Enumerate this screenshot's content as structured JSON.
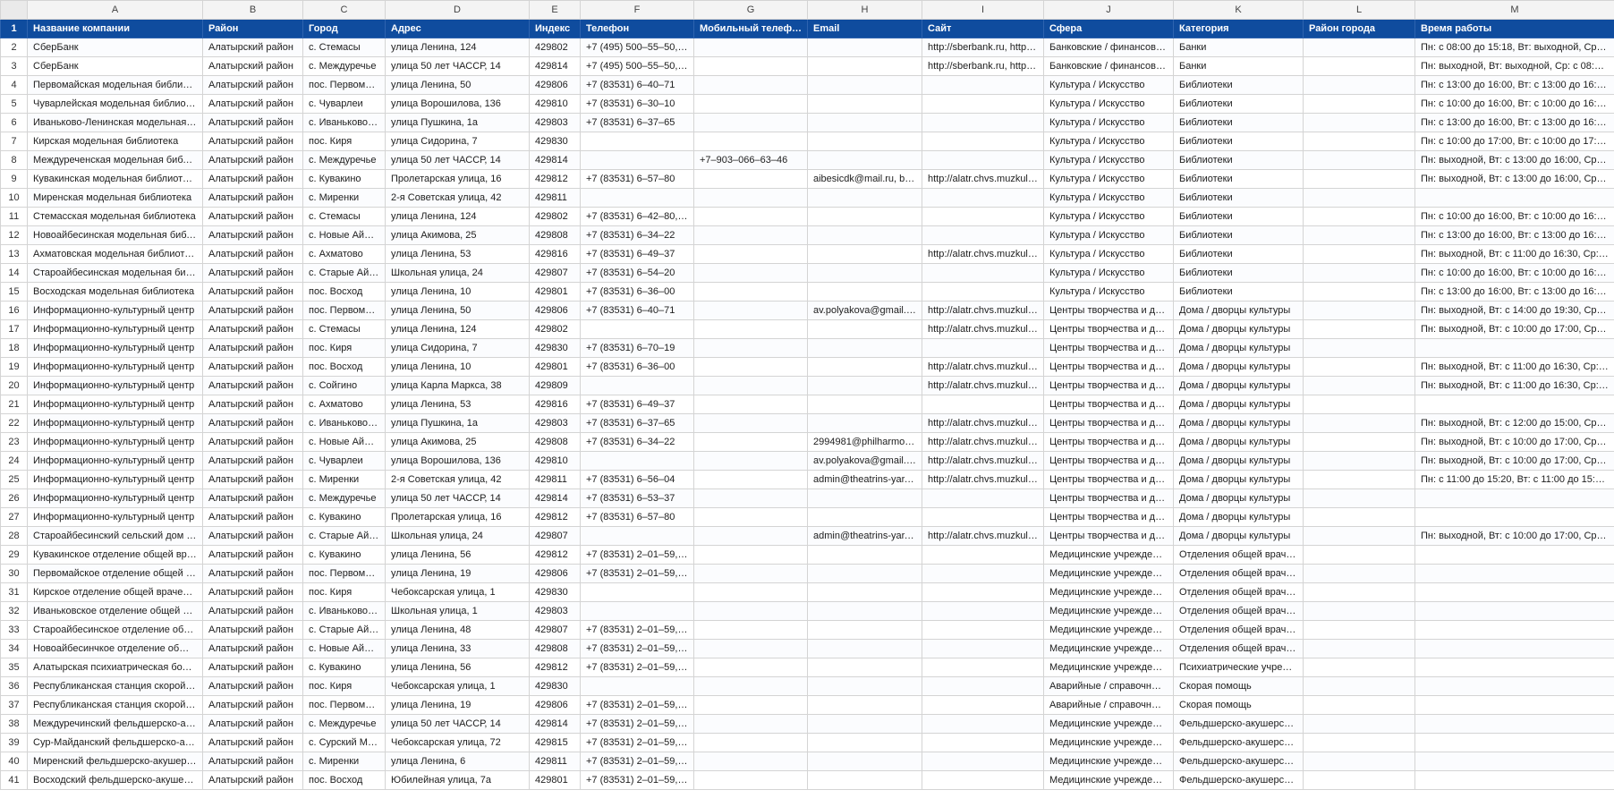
{
  "columns": [
    "A",
    "B",
    "C",
    "D",
    "E",
    "F",
    "G",
    "H",
    "I",
    "J",
    "K",
    "L",
    "M"
  ],
  "header_row_number": "1",
  "headers": [
    "Название компании",
    "Район",
    "Город",
    "Адрес",
    "Индекс",
    "Телефон",
    "Мобильный телефон",
    "Email",
    "Сайт",
    "Сфера",
    "Категория",
    "Район города",
    "Время работы"
  ],
  "rows": [
    {
      "n": "2",
      "c": [
        "СберБанк",
        "Алатырский район",
        "с. Стемасы",
        "улица Ленина, 124",
        "429802",
        "+7 (495) 500–55–50, 8–...",
        "",
        "",
        "http://sberbank.ru, http://...",
        "Банковские / финансовые ...",
        "Банки",
        "",
        "Пн: с 08:00 до 15:18, Вт: выходной, Ср: выход"
      ]
    },
    {
      "n": "3",
      "c": [
        "СберБанк",
        "Алатырский район",
        "с. Междуречье",
        "улица 50 лет ЧАССР, 14",
        "429814",
        "+7 (495) 500–55–50, 8–...",
        "",
        "",
        "http://sberbank.ru, http://...",
        "Банковские / финансовые ...",
        "Банки",
        "",
        "Пн: выходной, Вт: выходной, Ср: с 08:30 до 1"
      ]
    },
    {
      "n": "4",
      "c": [
        "Первомайская модельная библиотека",
        "Алатырский район",
        "пос. Первомай...",
        "улица Ленина, 50",
        "429806",
        "+7 (83531) 6–40–71",
        "",
        "",
        "",
        "Культура / Искусство",
        "Библиотеки",
        "",
        "Пн: с 13:00 до 16:00, Вт: с 13:00 до 16:00, Ср:"
      ]
    },
    {
      "n": "5",
      "c": [
        "Чуварлейская модельная библиотека",
        "Алатырский район",
        "с. Чуварлеи",
        "улица Ворошилова, 136",
        "429810",
        "+7 (83531) 6–30–10",
        "",
        "",
        "",
        "Культура / Искусство",
        "Библиотеки",
        "",
        "Пн: с 10:00 до 16:00, Вт: с 10:00 до 16:00, Ср:"
      ]
    },
    {
      "n": "6",
      "c": [
        "Иваньково-Ленинская модельная би...",
        "Алатырский район",
        "с. Иваньково-Л...",
        "улица Пушкина, 1а",
        "429803",
        "+7 (83531) 6–37–65",
        "",
        "",
        "",
        "Культура / Искусство",
        "Библиотеки",
        "",
        "Пн: с 13:00 до 16:00, Вт: с 13:00 до 16:00, Ср:"
      ]
    },
    {
      "n": "7",
      "c": [
        "Кирская модельная библиотека",
        "Алатырский район",
        "пос. Киря",
        "улица Сидорина, 7",
        "429830",
        "",
        "",
        "",
        "",
        "Культура / Искусство",
        "Библиотеки",
        "",
        "Пн: с 10:00 до 17:00, Вт: с 10:00 до 17:00, Ср:"
      ]
    },
    {
      "n": "8",
      "c": [
        "Междуреченская модельная библиот...",
        "Алатырский район",
        "с. Междуречье",
        "улица 50 лет ЧАССР, 14",
        "429814",
        "",
        "+7–903–066–63–46",
        "",
        "",
        "Культура / Искусство",
        "Библиотеки",
        "",
        "Пн: выходной, Вт: с 13:00 до 16:00, Ср: с 13:0"
      ]
    },
    {
      "n": "9",
      "c": [
        "Кувакинская модельная библиотека",
        "Алатырский район",
        "с. Кувакино",
        "Пролетарская улица, 16",
        "429812",
        "+7 (83531) 6–57–80",
        "",
        "aibesicdk@mail.ru, biblk...",
        "http://alatr.chvs.muzkult.ru",
        "Культура / Искусство",
        "Библиотеки",
        "",
        "Пн: выходной, Вт: с 13:00 до 16:00, Ср: с 13:0"
      ]
    },
    {
      "n": "10",
      "c": [
        "Миренская модельная библиотека",
        "Алатырский район",
        "с. Миренки",
        "2-я Советская улица, 42",
        "429811",
        "",
        "",
        "",
        "",
        "Культура / Искусство",
        "Библиотеки",
        "",
        ""
      ]
    },
    {
      "n": "11",
      "c": [
        "Стемасская модельная библиотека",
        "Алатырский район",
        "с. Стемасы",
        "улица Ленина, 124",
        "429802",
        "+7 (83531) 6–42–80, +7...",
        "",
        "",
        "",
        "Культура / Искусство",
        "Библиотеки",
        "",
        "Пн: с 10:00 до 16:00, Вт: с 10:00 до 16:00, Ср:"
      ]
    },
    {
      "n": "12",
      "c": [
        "Новоайбесинская модельная библио...",
        "Алатырский район",
        "с. Новые Айбеси",
        "улица Акимова, 25",
        "429808",
        "+7 (83531) 6–34–22",
        "",
        "",
        "",
        "Культура / Искусство",
        "Библиотеки",
        "",
        "Пн: с 13:00 до 16:00, Вт: с 13:00 до 16:00, Ср:"
      ]
    },
    {
      "n": "13",
      "c": [
        "Ахматовская модельная библиотека",
        "Алатырский район",
        "с. Ахматово",
        "улица Ленина, 53",
        "429816",
        "+7 (83531) 6–49–37",
        "",
        "",
        "http://alatr.chvs.muzkult.ru",
        "Культура / Искусство",
        "Библиотеки",
        "",
        "Пн: выходной, Вт: с 11:00 до 16:30, Ср: с 11:0"
      ]
    },
    {
      "n": "14",
      "c": [
        "Староайбесинская модельная библио...",
        "Алатырский район",
        "с. Старые Айбеси",
        "Школьная улица, 24",
        "429807",
        "+7 (83531) 6–54–20",
        "",
        "",
        "",
        "Культура / Искусство",
        "Библиотеки",
        "",
        "Пн: с 10:00 до 16:00, Вт: с 10:00 до 16:00, Ср:"
      ]
    },
    {
      "n": "15",
      "c": [
        "Восходская модельная библиотека",
        "Алатырский район",
        "пос. Восход",
        "улица Ленина, 10",
        "429801",
        "+7 (83531) 6–36–00",
        "",
        "",
        "",
        "Культура / Искусство",
        "Библиотеки",
        "",
        "Пн: с 13:00 до 16:00, Вт: с 13:00 до 16:00, Ср:"
      ]
    },
    {
      "n": "16",
      "c": [
        "Информационно-культурный центр",
        "Алатырский район",
        "пос. Первомай...",
        "улица Ленина, 50",
        "429806",
        "+7 (83531) 6–40–71",
        "",
        "av.polyakova@gmail.co...",
        "http://alatr.chvs.muzkult.r...",
        "Центры творчества и досуга",
        "Дома / дворцы культуры",
        "",
        "Пн: выходной, Вт: с 14:00 до 19:30, Ср: с 14:0"
      ]
    },
    {
      "n": "17",
      "c": [
        "Информационно-культурный центр",
        "Алатырский район",
        "с. Стемасы",
        "улица Ленина, 124",
        "429802",
        "",
        "",
        "",
        "http://alatr.chvs.muzkult.r...",
        "Центры творчества и досуга",
        "Дома / дворцы культуры",
        "",
        "Пн: выходной, Вт: с 10:00 до 17:00, Ср: с 10:0"
      ]
    },
    {
      "n": "18",
      "c": [
        "Информационно-культурный центр",
        "Алатырский район",
        "пос. Киря",
        "улица Сидорина, 7",
        "429830",
        "+7 (83531) 6–70–19",
        "",
        "",
        "",
        "Центры творчества и досуга",
        "Дома / дворцы культуры",
        "",
        ""
      ]
    },
    {
      "n": "19",
      "c": [
        "Информационно-культурный центр",
        "Алатырский район",
        "пос. Восход",
        "улица Ленина, 10",
        "429801",
        "+7 (83531) 6–36–00",
        "",
        "",
        "http://alatr.chvs.muzkult.r...",
        "Центры творчества и досуга",
        "Дома / дворцы культуры",
        "",
        "Пн: выходной, Вт: с 11:00 до 16:30, Ср: с 11:0"
      ]
    },
    {
      "n": "20",
      "c": [
        "Информационно-культурный центр",
        "Алатырский район",
        "с. Сойгино",
        "улица Карла Маркса, 38",
        "429809",
        "",
        "",
        "",
        "http://alatr.chvs.muzkult.r...",
        "Центры творчества и досуга",
        "Дома / дворцы культуры",
        "",
        "Пн: выходной, Вт: с 11:00 до 16:30, Ср: с 11:0"
      ]
    },
    {
      "n": "21",
      "c": [
        "Информационно-культурный центр",
        "Алатырский район",
        "с. Ахматово",
        "улица Ленина, 53",
        "429816",
        "+7 (83531) 6–49–37",
        "",
        "",
        "",
        "Центры творчества и досуга",
        "Дома / дворцы культуры",
        "",
        ""
      ]
    },
    {
      "n": "22",
      "c": [
        "Информационно-культурный центр",
        "Алатырский район",
        "с. Иваньково-Л...",
        "улица Пушкина, 1а",
        "429803",
        "+7 (83531) 6–37–65",
        "",
        "",
        "http://alatr.chvs.muzkult.r...",
        "Центры творчества и досуга",
        "Дома / дворцы культуры",
        "",
        "Пн: выходной, Вт: с 12:00 до 15:00, Ср: с 12:0"
      ]
    },
    {
      "n": "23",
      "c": [
        "Информационно-культурный центр",
        "Алатырский район",
        "с. Новые Айбеси",
        "улица Акимова, 25",
        "429808",
        "+7 (83531) 6–34–22",
        "",
        "2994981@philharmonia...",
        "http://alatr.chvs.muzkult.r...",
        "Центры творчества и досуга",
        "Дома / дворцы культуры",
        "",
        "Пн: выходной, Вт: с 10:00 до 17:00, Ср: с 10:0"
      ]
    },
    {
      "n": "24",
      "c": [
        "Информационно-культурный центр",
        "Алатырский район",
        "с. Чуварлеи",
        "улица Ворошилова, 136",
        "429810",
        "",
        "",
        "av.polyakova@gmail.co...",
        "http://alatr.chvs.muzkult.r...",
        "Центры творчества и досуга",
        "Дома / дворцы культуры",
        "",
        "Пн: выходной, Вт: с 10:00 до 17:00, Ср: с 10:0"
      ]
    },
    {
      "n": "25",
      "c": [
        "Информационно-культурный центр",
        "Алатырский район",
        "с. Миренки",
        "2-я Советская улица, 42",
        "429811",
        "+7 (83531) 6–56–04",
        "",
        "admin@theatrins-yar.ru,...",
        "http://alatr.chvs.muzkult.r...",
        "Центры творчества и досуга",
        "Дома / дворцы культуры",
        "",
        "Пн: с 11:00 до 15:20, Вт: с 11:00 до 15:20, Ср:"
      ]
    },
    {
      "n": "26",
      "c": [
        "Информационно-культурный центр",
        "Алатырский район",
        "с. Междуречье",
        "улица 50 лет ЧАССР, 14",
        "429814",
        "+7 (83531) 6–53–37",
        "",
        "",
        "",
        "Центры творчества и досуга",
        "Дома / дворцы культуры",
        "",
        ""
      ]
    },
    {
      "n": "27",
      "c": [
        "Информационно-культурный центр",
        "Алатырский район",
        "с. Кувакино",
        "Пролетарская улица, 16",
        "429812",
        "+7 (83531) 6–57–80",
        "",
        "",
        "",
        "Центры творчества и досуга",
        "Дома / дворцы культуры",
        "",
        ""
      ]
    },
    {
      "n": "28",
      "c": [
        "Староайбесинский сельский дом куль...",
        "Алатырский район",
        "с. Старые Айбеси",
        "Школьная улица, 24",
        "429807",
        "",
        "",
        "admin@theatrins-yar.ru,...",
        "http://alatr.chvs.muzkult.r...",
        "Центры творчества и досуга",
        "Дома / дворцы культуры",
        "",
        "Пн: выходной, Вт: с 10:00 до 17:00, Ср: с 10:0"
      ]
    },
    {
      "n": "29",
      "c": [
        "Кувакинское отделение общей враче...",
        "Алатырский район",
        "с. Кувакино",
        "улица Ленина, 56",
        "429812",
        "+7 (83531) 2–01–59, +7...",
        "",
        "",
        "",
        "Медицинские учреждения",
        "Отделения общей врачеб...",
        "",
        ""
      ]
    },
    {
      "n": "30",
      "c": [
        "Первомайское отделение общей вра...",
        "Алатырский район",
        "пос. Первомай...",
        "улица Ленина, 19",
        "429806",
        "+7 (83531) 2–01–59, +7...",
        "",
        "",
        "",
        "Медицинские учреждения",
        "Отделения общей врачеб...",
        "",
        ""
      ]
    },
    {
      "n": "31",
      "c": [
        "Кирское отделение общей врачебно...",
        "Алатырский район",
        "пос. Киря",
        "Чебоксарская улица, 1",
        "429830",
        "",
        "",
        "",
        "",
        "Медицинские учреждения",
        "Отделения общей врачеб...",
        "",
        ""
      ]
    },
    {
      "n": "32",
      "c": [
        "Иваньковское отделение общей врач...",
        "Алатырский район",
        "с. Иваньково-Л...",
        "Школьная улица, 1",
        "429803",
        "",
        "",
        "",
        "",
        "Медицинские учреждения",
        "Отделения общей врачеб...",
        "",
        ""
      ]
    },
    {
      "n": "33",
      "c": [
        "Староайбесинское отделение общей ...",
        "Алатырский район",
        "с. Старые Айбеси",
        "улица Ленина, 48",
        "429807",
        "+7 (83531) 2–01–59, +7...",
        "",
        "",
        "",
        "Медицинские учреждения",
        "Отделения общей врачеб...",
        "",
        ""
      ]
    },
    {
      "n": "34",
      "c": [
        "Новоайбесинчкое отделение общей ...",
        "Алатырский район",
        "с. Новые Айбеси",
        "улица Ленина, 33",
        "429808",
        "+7 (83531) 2–01–59, +7...",
        "",
        "",
        "",
        "Медицинские учреждения",
        "Отделения общей врачеб...",
        "",
        ""
      ]
    },
    {
      "n": "35",
      "c": [
        "Алатырская психиатрическая больница",
        "Алатырский район",
        "с. Кувакино",
        "улица Ленина, 56",
        "429812",
        "+7 (83531) 2–01–59, +7...",
        "",
        "",
        "",
        "Медицинские учреждения",
        "Психиатрические учрежде...",
        "",
        ""
      ]
    },
    {
      "n": "36",
      "c": [
        "Республиканская станция скорой мед...",
        "Алатырский район",
        "пос. Киря",
        "Чебоксарская улица, 1",
        "429830",
        "",
        "",
        "",
        "",
        "Аварийные / справочные ...",
        "Скорая помощь",
        "",
        ""
      ]
    },
    {
      "n": "37",
      "c": [
        "Республиканская станция скорой мед...",
        "Алатырский район",
        "пос. Первомай...",
        "улица Ленина, 19",
        "429806",
        "+7 (83531) 2–01–59, +7...",
        "",
        "",
        "",
        "Аварийные / справочные ...",
        "Скорая помощь",
        "",
        ""
      ]
    },
    {
      "n": "38",
      "c": [
        "Междуречинский фельдшерско-акуш...",
        "Алатырский район",
        "с. Междуречье",
        "улица 50 лет ЧАССР, 14",
        "429814",
        "+7 (83531) 2–01–59, +7...",
        "",
        "",
        "",
        "Медицинские учреждения",
        "Фельдшерско-акушерские...",
        "",
        ""
      ]
    },
    {
      "n": "39",
      "c": [
        "Сур-Майданский фельдшерско-акуш...",
        "Алатырский район",
        "с. Сурский Май...",
        "Чебоксарская улица, 72",
        "429815",
        "+7 (83531) 2–01–59, +7...",
        "",
        "",
        "",
        "Медицинские учреждения",
        "Фельдшерско-акушерские...",
        "",
        ""
      ]
    },
    {
      "n": "40",
      "c": [
        "Миренский фельдшерско-акушерски...",
        "Алатырский район",
        "с. Миренки",
        "улица Ленина, 6",
        "429811",
        "+7 (83531) 2–01–59, +7...",
        "",
        "",
        "",
        "Медицинские учреждения",
        "Фельдшерско-акушерские...",
        "",
        ""
      ]
    },
    {
      "n": "41",
      "c": [
        "Восходский фельдшерско-акушерск...",
        "Алатырский район",
        "пос. Восход",
        "Юбилейная улица, 7а",
        "429801",
        "+7 (83531) 2–01–59, +7...",
        "",
        "",
        "",
        "Медицинские учреждения",
        "Фельдшерско-акушерские...",
        "",
        ""
      ]
    }
  ]
}
